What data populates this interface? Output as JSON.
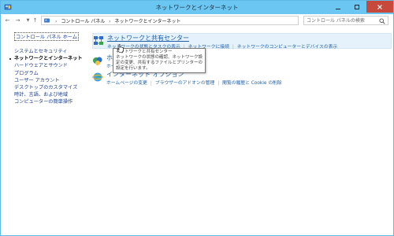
{
  "window": {
    "title": "ネットワークとインターネット",
    "controls": {
      "minimize": "–",
      "maximize": "□",
      "close": "✕"
    }
  },
  "addressbar": {
    "back_glyph": "←",
    "forward_glyph": "→",
    "dropdown_glyph": "▼",
    "up_glyph": "↑",
    "breadcrumbs": [
      "コントロール パネル",
      "ネットワークとインターネット"
    ],
    "separator": "›",
    "refresh_glyph": "↻",
    "search_placeholder": "コントロール パネルの検索"
  },
  "leftnav": {
    "home": "コントロール パネル ホーム",
    "items": [
      "システムとセキュリティ",
      "ネットワークとインターネット",
      "ハードウェアとサウンド",
      "プログラム",
      "ユーザー アカウント",
      "デスクトップのカスタマイズ",
      "時計、言語、および地域",
      "コンピューターの簡単操作"
    ],
    "current_index": 1
  },
  "categories": [
    {
      "icon": "network-sharing-center-icon",
      "title": "ネットワークと共有センター",
      "links": [
        "ネットワークの状態とタスクの表示",
        "ネットワークに接続",
        "ネットワークのコンピューターとデバイスの表示"
      ]
    },
    {
      "icon": "homegroup-icon",
      "title": "ホーム",
      "links": [
        "ホームグ"
      ]
    },
    {
      "icon": "internet-options-icon",
      "title": "インターネット オプション",
      "links": [
        "ホームページの変更",
        "ブラウザーのアドオンの管理",
        "閲覧の履歴と Cookie の削除"
      ]
    }
  ],
  "tooltip": {
    "lines": [
      "ネットワークと共有センター",
      "ネットワークの状態の確認、ネットワーク設",
      "定の変更、共有するファイルとプリンターの",
      "設定を行います。"
    ]
  },
  "colors": {
    "titlebar": "#6cc6f2",
    "close": "#c7493b",
    "link": "#1e5fa8",
    "hover_bg": "#e5f1fb"
  }
}
